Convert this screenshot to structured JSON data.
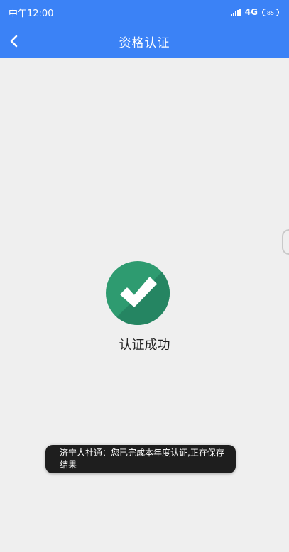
{
  "status_bar": {
    "time": "中午12:00",
    "network": "4G",
    "battery": "85"
  },
  "header": {
    "title": "资格认证"
  },
  "main": {
    "success_text": "认证成功"
  },
  "toast": {
    "message": "济宁人社通：您已完成本年度认证,正在保存结果"
  },
  "colors": {
    "brand": "#3b82f6",
    "success": "#2e9b70"
  },
  "icons": {
    "back": "chevron-left-icon",
    "success": "check-circle-icon"
  }
}
